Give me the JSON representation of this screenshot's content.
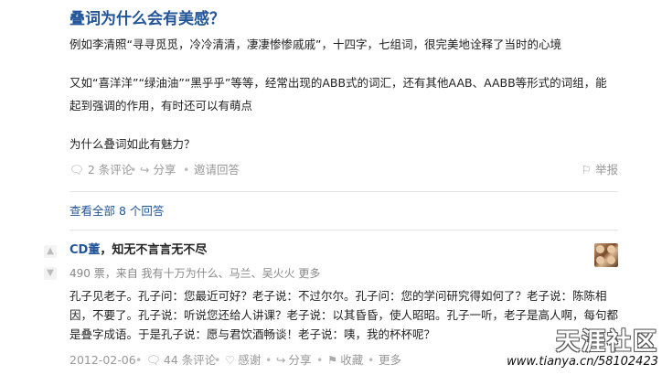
{
  "question": {
    "title": "叠词为什么会有美感？",
    "para1": "例如李清照“寻寻觅觅，冷冷清清，凄凄惨惨戚戚”，十四字，七组词，很完美地诠释了当时的心境",
    "para2": "又如“喜洋洋”“绿油油”“黑乎乎”等等，经常出现的ABB式的词汇，还有其他AAB、AABB等形式的词组，能起到强调的作用，有时还可以有萌点",
    "para3": "为什么叠词如此有魅力？",
    "comments_label": "2 条评论",
    "share_label": "分享",
    "invite_label": "邀请回答",
    "report_label": "举报",
    "view_all_label": "查看全部 8 个回答"
  },
  "answer": {
    "author_name": "CD董",
    "author_bio": "知无不言言无不尽",
    "votes_prefix": "490 票，来自",
    "voters": "我有十万为什么、马兰、吴火火",
    "more_label": "更多",
    "body": "孔子见老子。孔子问：您最近可好？老子说：不过尔尔。孔子问：您的学问研究得如何了？老子说：陈陈相因，不要了。孔子说：听说您还给人讲课？老子说：以其昏昏，使人昭昭。孔子一听，老子是高人啊，每句都是叠字成语。于是孔子说：愿与君饮酒畅谈！老子说：咦，我的杯杯呢？",
    "date": "2012-02-06",
    "comments_label": "44 条评论",
    "thanks_label": "感谢",
    "share_label": "分享",
    "collect_label": "收藏"
  },
  "watermark": {
    "brand": "天涯社区",
    "url": "www.tianya.cn/58102423"
  },
  "icons": {
    "comment": "comment-icon",
    "share": "share-icon",
    "invite": "invite-icon",
    "report": "flag-icon",
    "upvote": "upvote-icon",
    "downvote": "downvote-icon",
    "thanks": "heart-icon",
    "collect": "bookmark-icon"
  },
  "colors": {
    "link": "#225599",
    "muted": "#999999",
    "text": "#222222"
  }
}
